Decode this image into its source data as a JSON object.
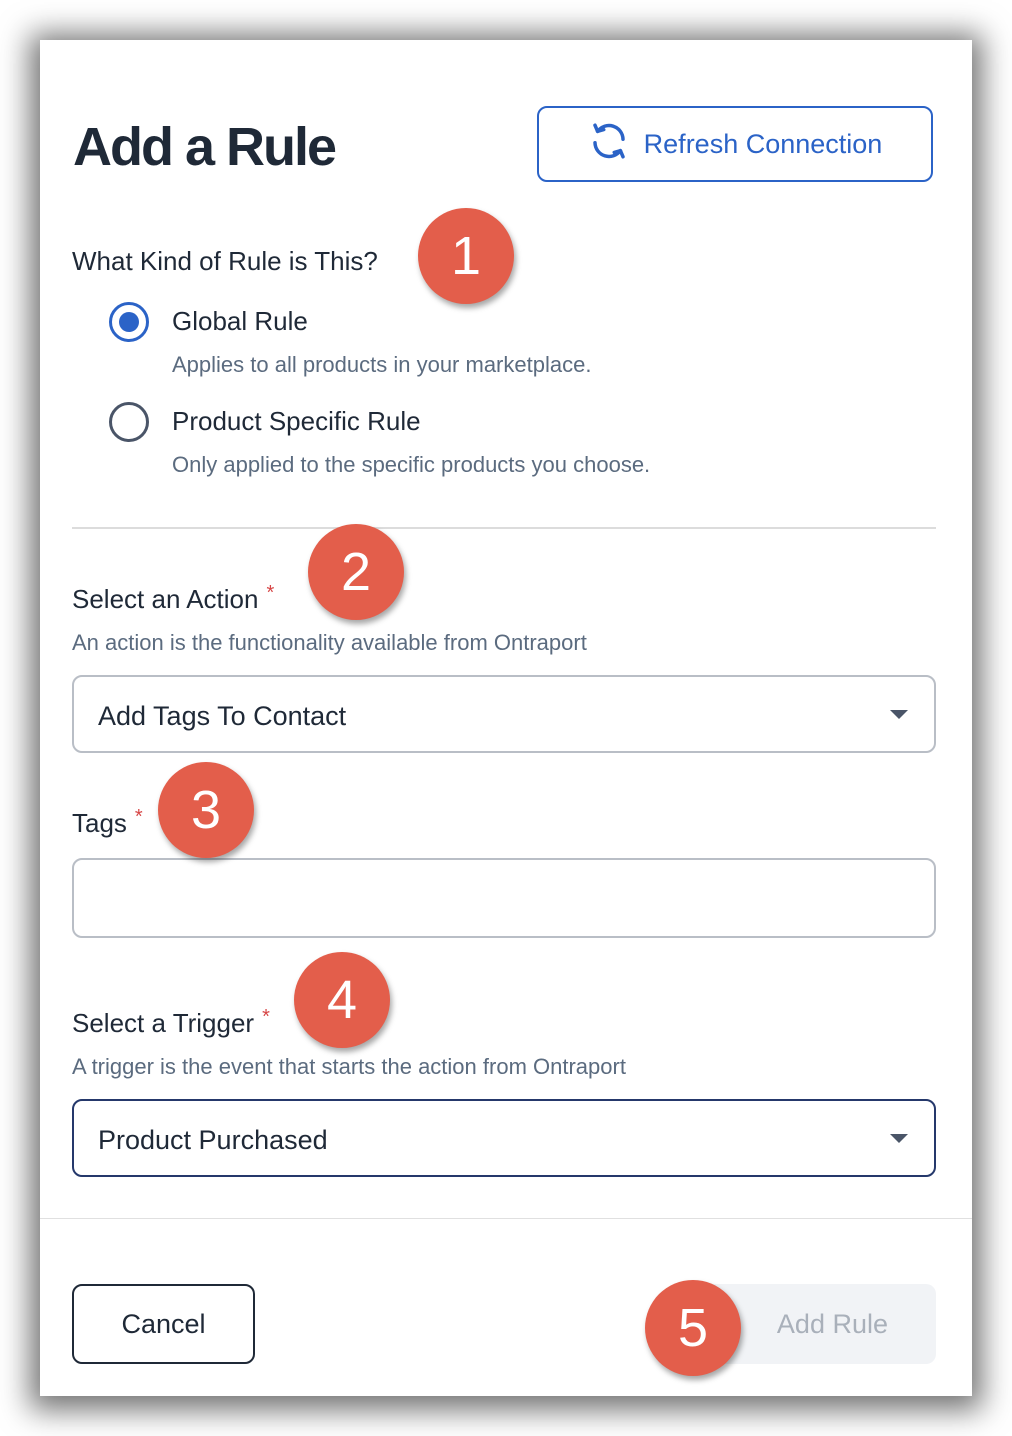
{
  "dialog": {
    "title": "Add a Rule",
    "refresh_label": "Refresh Connection"
  },
  "rule_kind": {
    "question": "What Kind of Rule is This?",
    "options": [
      {
        "label": "Global Rule",
        "description": "Applies to all products in your marketplace.",
        "selected": true
      },
      {
        "label": "Product Specific Rule",
        "description": "Only applied to the specific products you choose.",
        "selected": false
      }
    ]
  },
  "action": {
    "label": "Select an Action",
    "required_mark": "*",
    "help": "An action is the functionality available from Ontraport",
    "value": "Add Tags To Contact"
  },
  "tags": {
    "label": "Tags",
    "required_mark": "*",
    "value": ""
  },
  "trigger": {
    "label": "Select a Trigger",
    "required_mark": "*",
    "help": "A trigger is the event that starts the action from Ontraport",
    "value": "Product Purchased"
  },
  "footer": {
    "cancel_label": "Cancel",
    "add_label": "Add Rule"
  },
  "annotations": [
    "1",
    "2",
    "3",
    "4",
    "5"
  ],
  "colors": {
    "primary": "#2b63c7",
    "badge": "#e35e4b",
    "required": "#d64545"
  },
  "icons": {
    "refresh": "refresh-icon",
    "dropdown": "caret-down-icon"
  }
}
